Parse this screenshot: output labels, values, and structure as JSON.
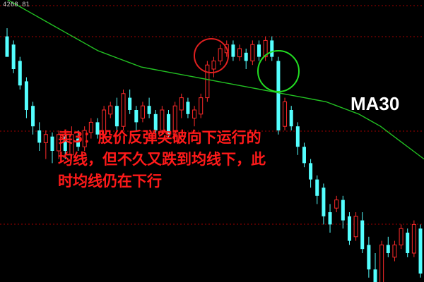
{
  "corner_label": "4268.81",
  "ma_label": "MA30",
  "caption_lines": [
    "卖3：股价反弹突破向下运行的",
    "均线，但不久又跌到均线下，此",
    "时均线仍在下行"
  ],
  "colors": {
    "up": "#ff2a2a",
    "down": "#54ffff",
    "ma": "#22c022",
    "red_circle": "#e02020",
    "green_circle": "#22dd22",
    "grid": "#a00000"
  },
  "chart_data": {
    "type": "candlestick",
    "grid": true,
    "ylim": [
      0,
      100
    ],
    "candles": [
      {
        "o": 96,
        "h": 100,
        "l": 86,
        "c": 86
      },
      {
        "o": 92,
        "h": 94,
        "l": 78,
        "c": 80
      },
      {
        "o": 84,
        "h": 86,
        "l": 70,
        "c": 72
      },
      {
        "o": 74,
        "h": 76,
        "l": 56,
        "c": 60
      },
      {
        "o": 62,
        "h": 64,
        "l": 48,
        "c": 52
      },
      {
        "o": 50,
        "h": 54,
        "l": 40,
        "c": 44
      },
      {
        "o": 44,
        "h": 50,
        "l": 36,
        "c": 48
      },
      {
        "o": 47,
        "h": 49,
        "l": 34,
        "c": 40
      },
      {
        "o": 40,
        "h": 50,
        "l": 36,
        "c": 48
      },
      {
        "o": 47,
        "h": 49,
        "l": 36,
        "c": 40
      },
      {
        "o": 38,
        "h": 52,
        "l": 36,
        "c": 48
      },
      {
        "o": 46,
        "h": 50,
        "l": 40,
        "c": 42
      },
      {
        "o": 42,
        "h": 52,
        "l": 40,
        "c": 50
      },
      {
        "o": 49,
        "h": 56,
        "l": 46,
        "c": 54
      },
      {
        "o": 54,
        "h": 56,
        "l": 46,
        "c": 48
      },
      {
        "o": 48,
        "h": 62,
        "l": 46,
        "c": 60
      },
      {
        "o": 58,
        "h": 64,
        "l": 56,
        "c": 62
      },
      {
        "o": 62,
        "h": 66,
        "l": 50,
        "c": 52
      },
      {
        "o": 52,
        "h": 70,
        "l": 50,
        "c": 68
      },
      {
        "o": 66,
        "h": 70,
        "l": 58,
        "c": 60
      },
      {
        "o": 60,
        "h": 62,
        "l": 50,
        "c": 54
      },
      {
        "o": 56,
        "h": 64,
        "l": 54,
        "c": 62
      },
      {
        "o": 62,
        "h": 66,
        "l": 56,
        "c": 58
      },
      {
        "o": 58,
        "h": 60,
        "l": 48,
        "c": 50
      },
      {
        "o": 50,
        "h": 62,
        "l": 48,
        "c": 60
      },
      {
        "o": 58,
        "h": 60,
        "l": 46,
        "c": 48
      },
      {
        "o": 48,
        "h": 64,
        "l": 46,
        "c": 62
      },
      {
        "o": 60,
        "h": 68,
        "l": 56,
        "c": 66
      },
      {
        "o": 64,
        "h": 66,
        "l": 56,
        "c": 58
      },
      {
        "o": 56,
        "h": 62,
        "l": 52,
        "c": 60
      },
      {
        "o": 58,
        "h": 68,
        "l": 56,
        "c": 66
      },
      {
        "o": 66,
        "h": 84,
        "l": 64,
        "c": 82
      },
      {
        "o": 80,
        "h": 86,
        "l": 76,
        "c": 84
      },
      {
        "o": 84,
        "h": 92,
        "l": 82,
        "c": 90
      },
      {
        "o": 88,
        "h": 94,
        "l": 86,
        "c": 92
      },
      {
        "o": 92,
        "h": 94,
        "l": 84,
        "c": 86
      },
      {
        "o": 86,
        "h": 92,
        "l": 84,
        "c": 90
      },
      {
        "o": 88,
        "h": 90,
        "l": 80,
        "c": 84
      },
      {
        "o": 84,
        "h": 94,
        "l": 82,
        "c": 92
      },
      {
        "o": 92,
        "h": 94,
        "l": 84,
        "c": 86
      },
      {
        "o": 86,
        "h": 96,
        "l": 84,
        "c": 94
      },
      {
        "o": 94,
        "h": 96,
        "l": 84,
        "c": 86
      },
      {
        "o": 84,
        "h": 86,
        "l": 48,
        "c": 50
      },
      {
        "o": 52,
        "h": 66,
        "l": 50,
        "c": 64
      },
      {
        "o": 60,
        "h": 62,
        "l": 50,
        "c": 52
      },
      {
        "o": 52,
        "h": 54,
        "l": 38,
        "c": 42
      },
      {
        "o": 42,
        "h": 44,
        "l": 32,
        "c": 34
      },
      {
        "o": 34,
        "h": 36,
        "l": 22,
        "c": 26
      },
      {
        "o": 26,
        "h": 28,
        "l": 14,
        "c": 18
      },
      {
        "o": 22,
        "h": 24,
        "l": 4,
        "c": 8
      },
      {
        "o": 10,
        "h": 14,
        "l": 0,
        "c": 4
      },
      {
        "o": 12,
        "h": 18,
        "l": 10,
        "c": 16
      },
      {
        "o": 16,
        "h": 18,
        "l": 2,
        "c": 6
      },
      {
        "o": 8,
        "h": 10,
        "l": -6,
        "c": -4
      },
      {
        "o": -2,
        "h": 10,
        "l": -4,
        "c": 8
      },
      {
        "o": 6,
        "h": 10,
        "l": -10,
        "c": -8
      },
      {
        "o": -6,
        "h": -2,
        "l": -22,
        "c": -18
      },
      {
        "o": -18,
        "h": -10,
        "l": -30,
        "c": -26
      },
      {
        "o": -26,
        "h": -4,
        "l": -28,
        "c": -6
      },
      {
        "o": -6,
        "h": -2,
        "l": -12,
        "c": -10
      },
      {
        "o": -12,
        "h": -4,
        "l": -14,
        "c": -6
      },
      {
        "o": -6,
        "h": 4,
        "l": -8,
        "c": 2
      },
      {
        "o": 0,
        "h": 2,
        "l": -12,
        "c": -10
      },
      {
        "o": -10,
        "h": 6,
        "l": -12,
        "c": 4
      },
      {
        "o": 2,
        "h": 4,
        "l": -22,
        "c": -20
      }
    ],
    "ma30": [
      116,
      113,
      110,
      107,
      104,
      101,
      98,
      95,
      92,
      89,
      87,
      85,
      83,
      81,
      80,
      79,
      78,
      77,
      76,
      75,
      74,
      73,
      72,
      71,
      70,
      69,
      68,
      67,
      66,
      65,
      64,
      62,
      60,
      58,
      55,
      52,
      48,
      44,
      40,
      36
    ]
  }
}
